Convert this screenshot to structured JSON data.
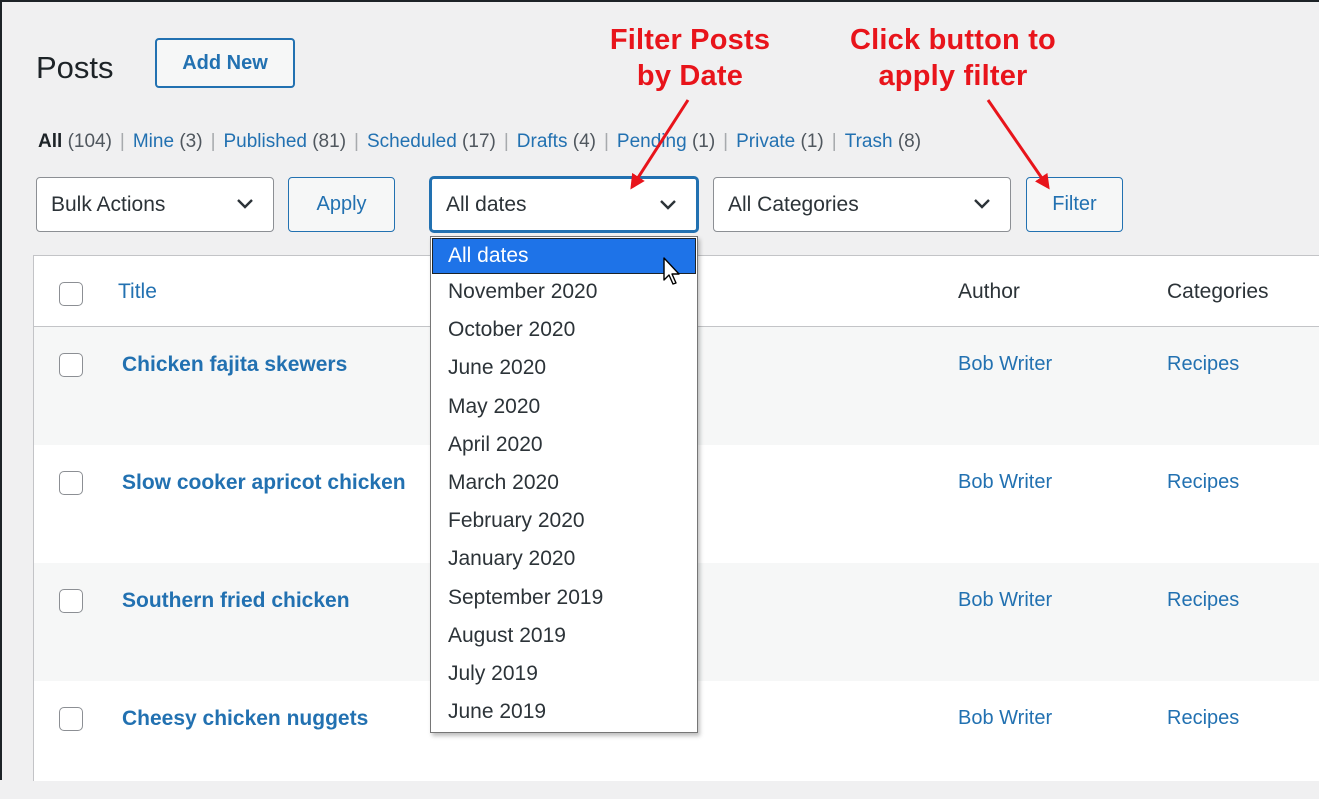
{
  "page": {
    "title": "Posts",
    "add_new_label": "Add New"
  },
  "views": [
    {
      "label": "All",
      "count": "(104)"
    },
    {
      "label": "Mine",
      "count": "(3)"
    },
    {
      "label": "Published",
      "count": "(81)"
    },
    {
      "label": "Scheduled",
      "count": "(17)"
    },
    {
      "label": "Drafts",
      "count": "(4)"
    },
    {
      "label": "Pending",
      "count": "(1)"
    },
    {
      "label": "Private",
      "count": "(1)"
    },
    {
      "label": "Trash",
      "count": "(8)"
    }
  ],
  "separator": "|",
  "toolbar": {
    "bulk_actions": "Bulk Actions",
    "apply": "Apply",
    "dates_selected": "All dates",
    "categories_selected": "All Categories",
    "filter": "Filter"
  },
  "date_options": [
    "All dates",
    "November 2020",
    "October 2020",
    "June 2020",
    "May 2020",
    "April 2020",
    "March 2020",
    "February 2020",
    "January 2020",
    "September 2019",
    "August 2019",
    "July 2019",
    "June 2019"
  ],
  "table": {
    "columns": {
      "title": "Title",
      "author": "Author",
      "categories": "Categories"
    },
    "rows": [
      {
        "title": "Chicken fajita skewers",
        "author": "Bob Writer",
        "category": "Recipes"
      },
      {
        "title": "Slow cooker apricot chicken",
        "author": "Bob Writer",
        "category": "Recipes"
      },
      {
        "title": "Southern fried chicken",
        "author": "Bob Writer",
        "category": "Recipes"
      },
      {
        "title": "Cheesy chicken nuggets",
        "author": "Bob Writer",
        "category": "Recipes"
      }
    ]
  },
  "annotations": {
    "filter_by_date": [
      "Filter Posts",
      "by Date"
    ],
    "click_filter": [
      "Click button to",
      "apply filter"
    ]
  },
  "colors": {
    "link": "#2271b1",
    "annotation": "#e8141b",
    "selected_option": "#1e73e8"
  }
}
